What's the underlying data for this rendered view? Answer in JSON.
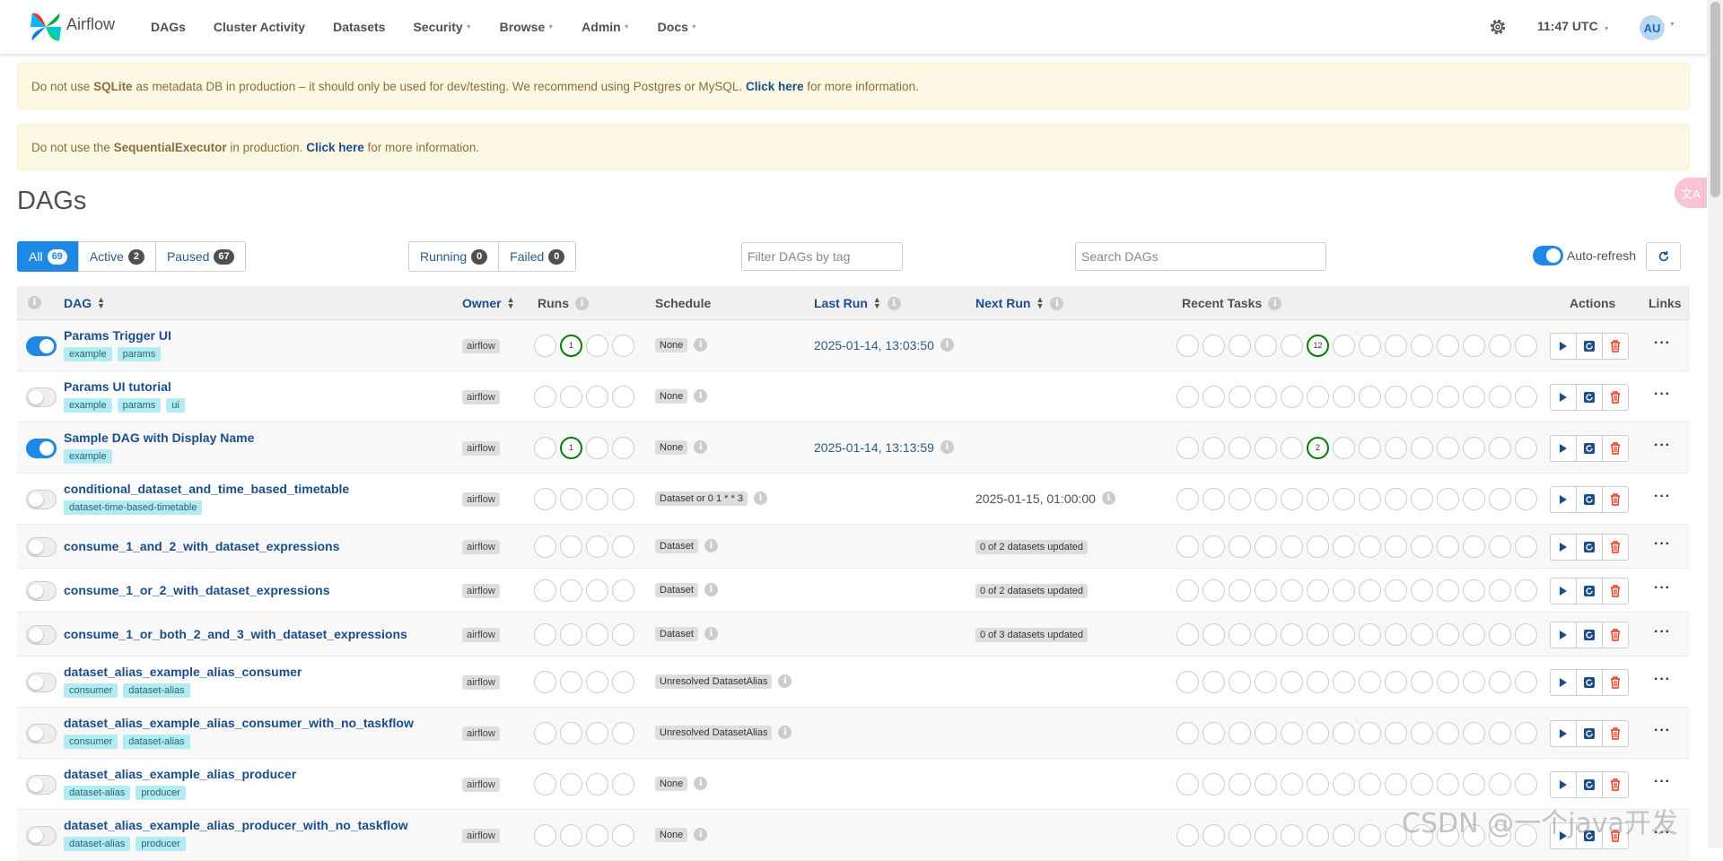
{
  "app": {
    "name": "Airflow"
  },
  "nav": {
    "items": [
      "DAGs",
      "Cluster Activity",
      "Datasets",
      "Security",
      "Browse",
      "Admin",
      "Docs"
    ],
    "time": "11:47 UTC",
    "avatar": "AU"
  },
  "alerts": [
    {
      "pre": "Do not use ",
      "bold": "SQLite",
      "mid": " as metadata DB in production – it should only be used for dev/testing. We recommend using Postgres or MySQL. ",
      "link": "Click here",
      "post": " for more information."
    },
    {
      "pre": "Do not use the ",
      "bold": "SequentialExecutor",
      "mid": " in production. ",
      "link": "Click here",
      "post": " for more information."
    }
  ],
  "page_title": "DAGs",
  "filters": {
    "all": {
      "label": "All",
      "count": "69"
    },
    "active": {
      "label": "Active",
      "count": "2"
    },
    "paused": {
      "label": "Paused",
      "count": "67"
    },
    "running": {
      "label": "Running",
      "count": "0"
    },
    "failed": {
      "label": "Failed",
      "count": "0"
    },
    "tag_placeholder": "Filter DAGs by tag",
    "search_placeholder": "Search DAGs",
    "auto_refresh": "Auto-refresh"
  },
  "columns": {
    "dag": "DAG",
    "owner": "Owner",
    "runs": "Runs",
    "schedule": "Schedule",
    "last_run": "Last Run",
    "next_run": "Next Run",
    "recent_tasks": "Recent Tasks",
    "actions": "Actions",
    "links": "Links"
  },
  "dags": [
    {
      "name": "Params Trigger UI",
      "tags": [
        "example",
        "params"
      ],
      "on": true,
      "owner": "airflow",
      "runs_success": "1",
      "schedule": "None",
      "last_run": "2025-01-14, 13:03:50",
      "next_run": "",
      "recent_success": "12"
    },
    {
      "name": "Params UI tutorial",
      "tags": [
        "example",
        "params",
        "ui"
      ],
      "on": false,
      "owner": "airflow",
      "runs_success": "",
      "schedule": "None",
      "last_run": "",
      "next_run": "",
      "recent_success": ""
    },
    {
      "name": "Sample DAG with Display Name",
      "tags": [
        "example"
      ],
      "on": true,
      "owner": "airflow",
      "runs_success": "1",
      "schedule": "None",
      "last_run": "2025-01-14, 13:13:59",
      "next_run": "",
      "recent_success": "2"
    },
    {
      "name": "conditional_dataset_and_time_based_timetable",
      "tags": [
        "dataset-time-based-timetable"
      ],
      "on": false,
      "owner": "airflow",
      "runs_success": "",
      "schedule": "Dataset or 0 1 * * 3",
      "last_run": "",
      "next_run": "2025-01-15, 01:00:00",
      "recent_success": ""
    },
    {
      "name": "consume_1_and_2_with_dataset_expressions",
      "tags": [],
      "on": false,
      "owner": "airflow",
      "runs_success": "",
      "schedule": "Dataset",
      "last_run": "",
      "next_run_label": "0 of 2 datasets updated",
      "recent_success": ""
    },
    {
      "name": "consume_1_or_2_with_dataset_expressions",
      "tags": [],
      "on": false,
      "owner": "airflow",
      "runs_success": "",
      "schedule": "Dataset",
      "last_run": "",
      "next_run_label": "0 of 2 datasets updated",
      "recent_success": ""
    },
    {
      "name": "consume_1_or_both_2_and_3_with_dataset_expressions",
      "tags": [],
      "on": false,
      "owner": "airflow",
      "runs_success": "",
      "schedule": "Dataset",
      "last_run": "",
      "next_run_label": "0 of 3 datasets updated",
      "recent_success": ""
    },
    {
      "name": "dataset_alias_example_alias_consumer",
      "tags": [
        "consumer",
        "dataset-alias"
      ],
      "on": false,
      "owner": "airflow",
      "runs_success": "",
      "schedule": "Unresolved DatasetAlias",
      "last_run": "",
      "next_run": "",
      "recent_success": ""
    },
    {
      "name": "dataset_alias_example_alias_consumer_with_no_taskflow",
      "tags": [
        "consumer",
        "dataset-alias"
      ],
      "on": false,
      "owner": "airflow",
      "runs_success": "",
      "schedule": "Unresolved DatasetAlias",
      "last_run": "",
      "next_run": "",
      "recent_success": ""
    },
    {
      "name": "dataset_alias_example_alias_producer",
      "tags": [
        "dataset-alias",
        "producer"
      ],
      "on": false,
      "owner": "airflow",
      "runs_success": "",
      "schedule": "None",
      "last_run": "",
      "next_run": "",
      "recent_success": ""
    },
    {
      "name": "dataset_alias_example_alias_producer_with_no_taskflow",
      "tags": [
        "dataset-alias",
        "producer"
      ],
      "on": false,
      "owner": "airflow",
      "runs_success": "",
      "schedule": "None",
      "last_run": "",
      "next_run": "",
      "recent_success": ""
    }
  ],
  "watermark": "CSDN @一个java开发",
  "colors": {
    "accent": "#1e88e5",
    "success": "#008000",
    "link": "#1a4d8c",
    "alert_bg": "#fcf8e3",
    "tag_bg": "#b2ebf2"
  }
}
